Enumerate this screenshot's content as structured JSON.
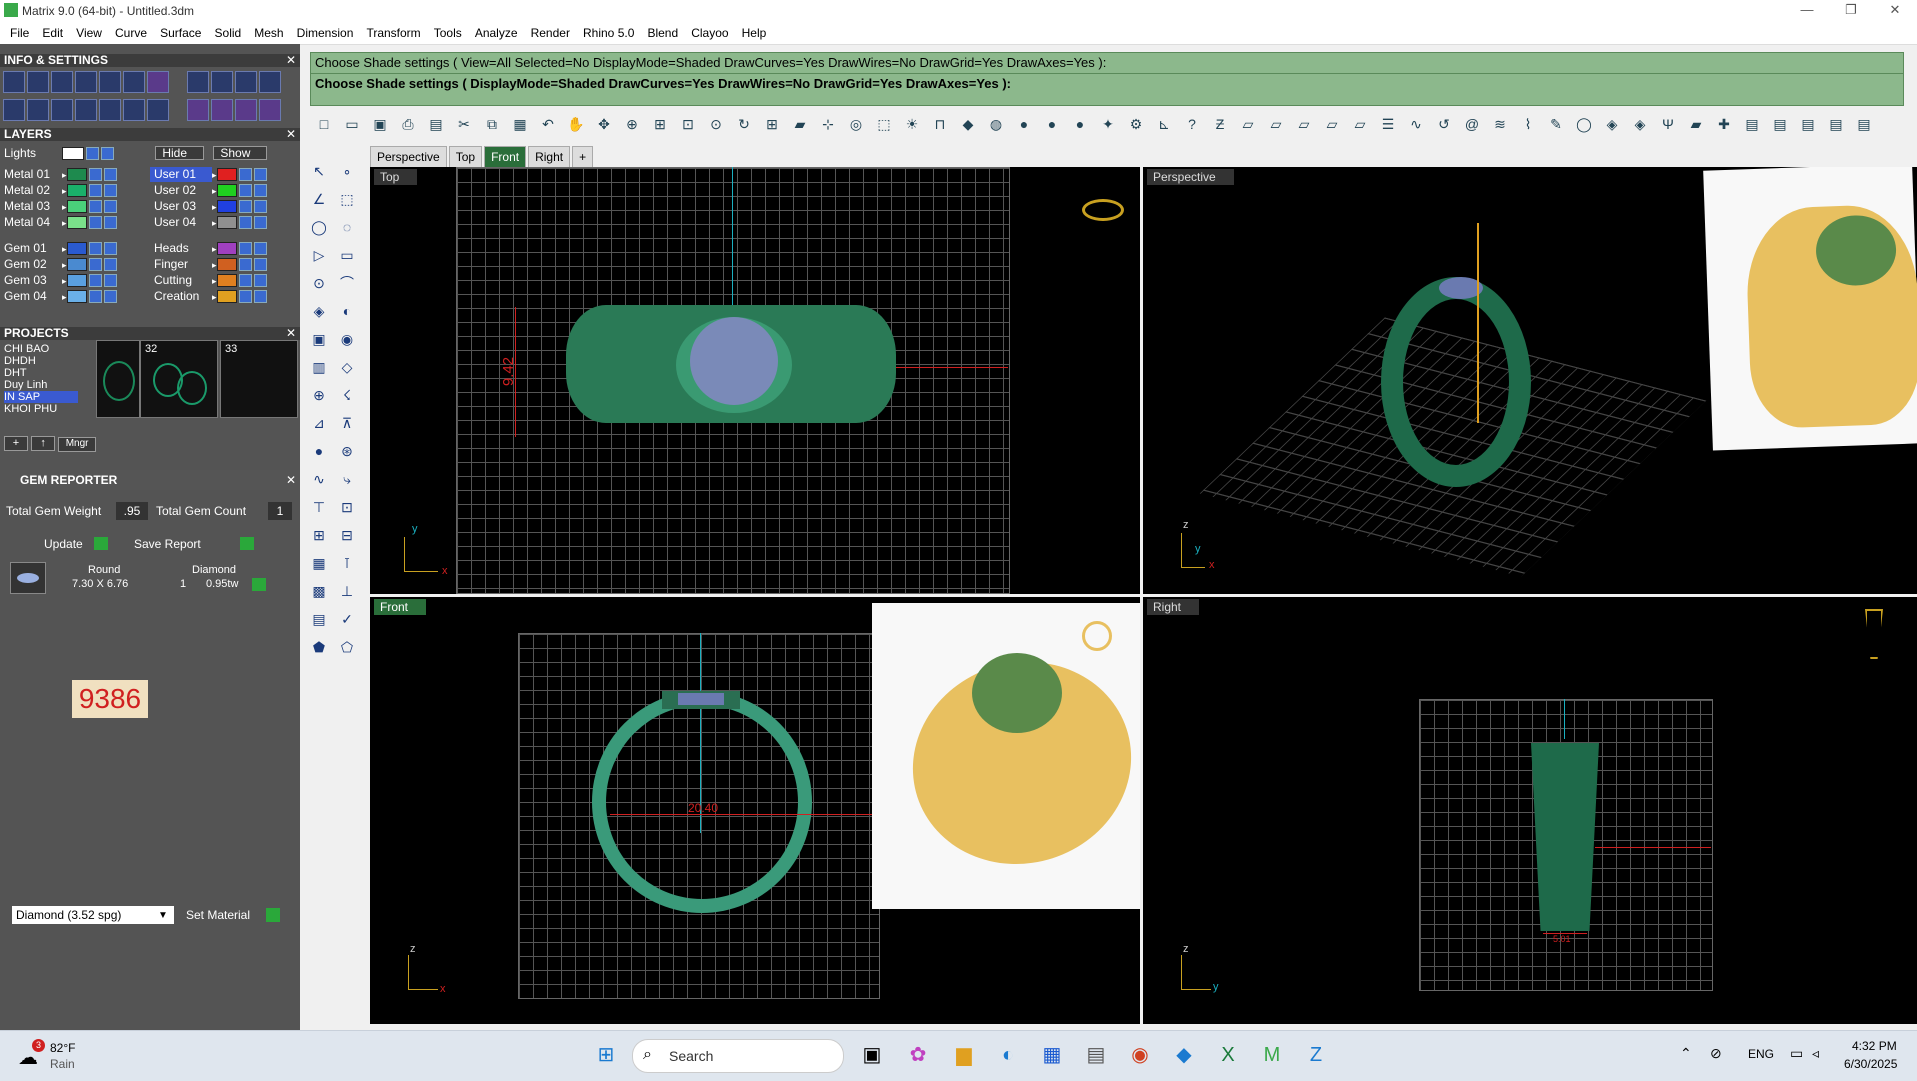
{
  "app": {
    "title": "Matrix 9.0 (64-bit) - Untitled.3dm",
    "minimize": "—",
    "maximize": "❐",
    "close": "✕"
  },
  "menu": [
    "File",
    "Edit",
    "View",
    "Curve",
    "Surface",
    "Solid",
    "Mesh",
    "Dimension",
    "Transform",
    "Tools",
    "Analyze",
    "Render",
    "Rhino 5.0",
    "Blend",
    "Clayoo",
    "Help"
  ],
  "panels": {
    "info_title": "INFO & SETTINGS",
    "layers_title": "LAYERS",
    "projects_title": "PROJECTS",
    "gem_title": "GEM REPORTER"
  },
  "layers": {
    "lights": "Lights",
    "hide": "Hide",
    "show": "Show",
    "left": [
      {
        "name": "Metal 01",
        "color": "#1e8a4e"
      },
      {
        "name": "Metal 02",
        "color": "#1ab06a"
      },
      {
        "name": "Metal 03",
        "color": "#4ad07a"
      },
      {
        "name": "Metal 04",
        "color": "#7ae08a"
      },
      {
        "name": "Gem 01",
        "color": "#2a5ad0"
      },
      {
        "name": "Gem 02",
        "color": "#4a8ad0"
      },
      {
        "name": "Gem 03",
        "color": "#5aa0e0"
      },
      {
        "name": "Gem 04",
        "color": "#6ab0e8"
      }
    ],
    "right": [
      {
        "name": "User 01",
        "color": "#e02020"
      },
      {
        "name": "User 02",
        "color": "#20d020"
      },
      {
        "name": "User 03",
        "color": "#2040e0"
      },
      {
        "name": "User 04",
        "color": "#909090"
      },
      {
        "name": "Heads",
        "color": "#a040c0"
      },
      {
        "name": "Finger",
        "color": "#d06020"
      },
      {
        "name": "Cutting",
        "color": "#e08020"
      },
      {
        "name": "Creation",
        "color": "#e0a020"
      }
    ]
  },
  "projects": {
    "items": [
      "CHI BAO",
      "DHDH",
      "DHT",
      "Duy Linh",
      "IN SAP",
      "KHOI PHU"
    ],
    "selected": "IN SAP",
    "thumbs": [
      "32",
      "33"
    ],
    "mgr": "Mngr"
  },
  "gem": {
    "weight_label": "Total Gem Weight",
    "weight": ".95",
    "count_label": "Total Gem Count",
    "count": "1",
    "update": "Update",
    "save": "Save Report",
    "col_shape": "Round",
    "col_material": "Diamond",
    "size": "7.30 X 6.76",
    "qty": "1",
    "tw": "0.95tw",
    "number": "9386",
    "material_select": "Diamond   (3.52 spg)",
    "set_material": "Set Material"
  },
  "command": {
    "line1": "Choose Shade settings ( View=All  Selected=No  DisplayMode=Shaded  DrawCurves=Yes  DrawWires=No  DrawGrid=Yes  DrawAxes=Yes ):",
    "line2": "Choose Shade settings ( DisplayMode=Shaded  DrawCurves=Yes  DrawWires=No  DrawGrid=Yes  DrawAxes=Yes ):"
  },
  "tabs": [
    "Perspective",
    "Top",
    "Front",
    "Right",
    "+"
  ],
  "active_tab": "Front",
  "viewports": {
    "top": {
      "label": "Top",
      "dim": "9.42"
    },
    "perspective": {
      "label": "Perspective"
    },
    "front": {
      "label": "Front",
      "dim": "20.40"
    },
    "right": {
      "label": "Right",
      "dim": "5.01"
    }
  },
  "axes": {
    "y": "y",
    "x": "x",
    "z": "z"
  },
  "taskbar": {
    "weather_temp": "82°F",
    "weather_desc": "Rain",
    "badge": "3",
    "search": "Search",
    "lang": "ENG",
    "time": "4:32 PM",
    "date": "6/30/2025"
  }
}
